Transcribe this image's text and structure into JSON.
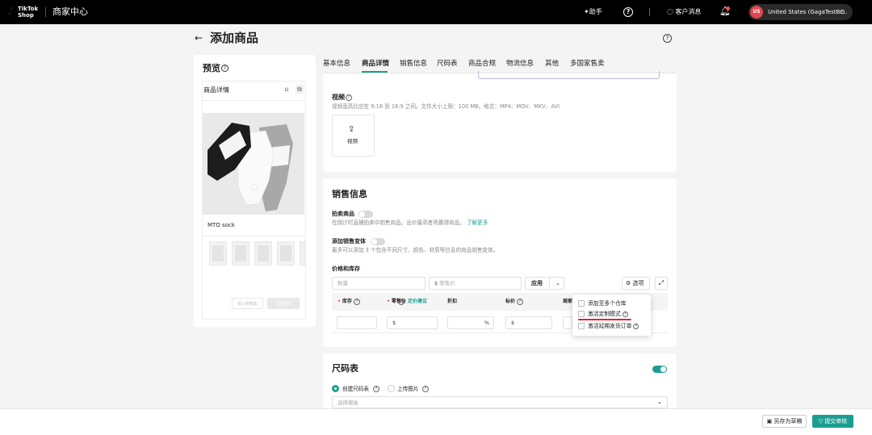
{
  "topbar": {
    "logo_text": "TikTok Shop",
    "portal_title": "商家中心",
    "assistant": "助手",
    "help_icon": "?",
    "customer_msg": "客户消息",
    "account_avatar": "US",
    "account_name": "United States (GagaTestBr..."
  },
  "page": {
    "title": "添加商品",
    "back_icon": "←",
    "help_icon": "?"
  },
  "preview": {
    "title": "预览",
    "help": "?",
    "detail_label": "商品详情",
    "product_name": "MTO sock",
    "btn_cart": "加入购物车",
    "btn_buy": "立即购买"
  },
  "tabs": [
    "基本信息",
    "商品详情",
    "销售信息",
    "尺码表",
    "商品合规",
    "物流信息",
    "其他",
    "多国家售卖"
  ],
  "active_tab": "商品详情",
  "video": {
    "label": "视频",
    "hint": "视频宽高比应在 9:16 到 16:9 之间。文件大小上限：100 MB。格式：MP4、MOV、MKV、AVI",
    "upload_label": "视频",
    "upload_icon": "upload-icon"
  },
  "sales": {
    "title": "销售信息",
    "auction_label": "拍卖商品",
    "auction_hint": "在倒计时直播拍卖中销售商品。出价最高者将赢得商品。",
    "auction_link": "了解更多",
    "variant_label": "添加销售变体",
    "variant_hint": "最多可以添加 3 个包含不同尺寸、颜色、材质等信息的商品销售变体。",
    "price_stock_label": "价格和库存",
    "qty_placeholder": "数量",
    "price_placeholder": "零售价",
    "currency": "$",
    "apply_label": "应用",
    "options_label": "选项",
    "columns": {
      "stock": "库存",
      "retail": "零售价",
      "pricing_tip": "定价建议",
      "discount": "折扣",
      "list_price": "标价",
      "merchant": "商家"
    },
    "discount_unit": "%"
  },
  "dropdown": {
    "items": [
      "添加至多个仓库",
      "激活定制模式",
      "激活延期发货订单"
    ]
  },
  "size_chart": {
    "title": "尺码表",
    "option_create": "创建尺码表",
    "option_upload": "上传图片",
    "template_placeholder": "选择模板"
  },
  "footer": {
    "draft": "另存为草稿",
    "submit": "提交审核"
  },
  "colors": {
    "accent": "#1b9e91",
    "highlight": "#e0233a",
    "avatar": "#e0464f"
  }
}
